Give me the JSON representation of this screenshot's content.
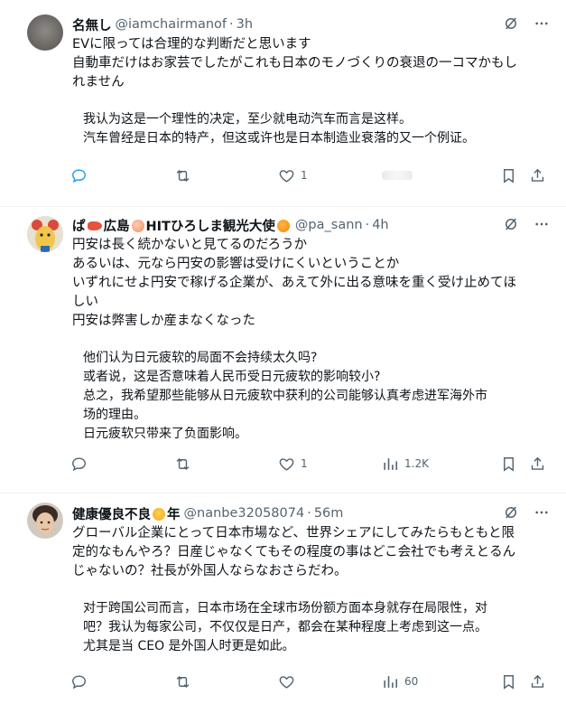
{
  "posts": [
    {
      "name": "名無し",
      "handle": "@iamchairmanof",
      "dot": "·",
      "time": "3h",
      "text": [
        "EVに限っては合理的な判断だと思います",
        "自動車だけはお家芸でしたがこれも日本のモノづくりの衰退の一コマかもし",
        "れません"
      ],
      "translation": [
        "我认为这是一个理性的决定，至少就电动汽车而言是这样。",
        "汽车曾经是日本的特产，但这或许也是日本制造业衰落的又一个例证。"
      ],
      "actions": {
        "reply": "",
        "repost": "",
        "like": "1",
        "views": ""
      }
    },
    {
      "name": "ぱ🦐広島🍑HITひろしま観光大使🍊",
      "name_parts": [
        "ぱ",
        "広島",
        "HITひろしま観光大使"
      ],
      "handle": "@pa_sann",
      "dot": "·",
      "time": "4h",
      "text": [
        "円安は長く続かないと見てるのだろうか",
        "あるいは、元なら円安の影響は受けにくいということか",
        "いずれにせよ円安で稼げる企業が、あえて外に出る意味を重く受け止めてほ",
        "しい",
        "円安は弊害しか産まなくなった"
      ],
      "translation": [
        "他们认为日元疲软的局面不会持续太久吗?",
        "或者说，这是否意味着人民币受日元疲软的影响较小?",
        "总之，我希望那些能够从日元疲软中获利的公司能够认真考虑进军海外市",
        "场的理由。",
        "日元疲软只带来了负面影响。"
      ],
      "actions": {
        "reply": "",
        "repost": "",
        "like": "1",
        "views": "1.2K"
      }
    },
    {
      "name": "健康優良不良",
      "name_suffix": "年",
      "handle": "@nanbe32058074",
      "dot": "·",
      "time": "56m",
      "text": [
        "グローバル企業にとって日本市場など、世界シェアにしてみたらもともと限",
        "定的なもんやろ？日産じゃなくてもその程度の事はどこ会社でも考えとるん",
        "じゃないの？社長が外国人ならなおさらだわ。"
      ],
      "translation": [
        "对于跨国公司而言，日本市场在全球市场份额方面本身就存在局限性，对",
        "吧？我认为每家公司，不仅仅是日产，都会在某种程度上考虑到这一点。",
        "尤其是当 CEO 是外国人时更是如此。"
      ],
      "actions": {
        "reply": "",
        "repost": "",
        "like": "",
        "views": "60"
      }
    }
  ],
  "colors": {
    "text": "#0f1419",
    "secondary": "#536471",
    "divider": "#eff3f4"
  }
}
